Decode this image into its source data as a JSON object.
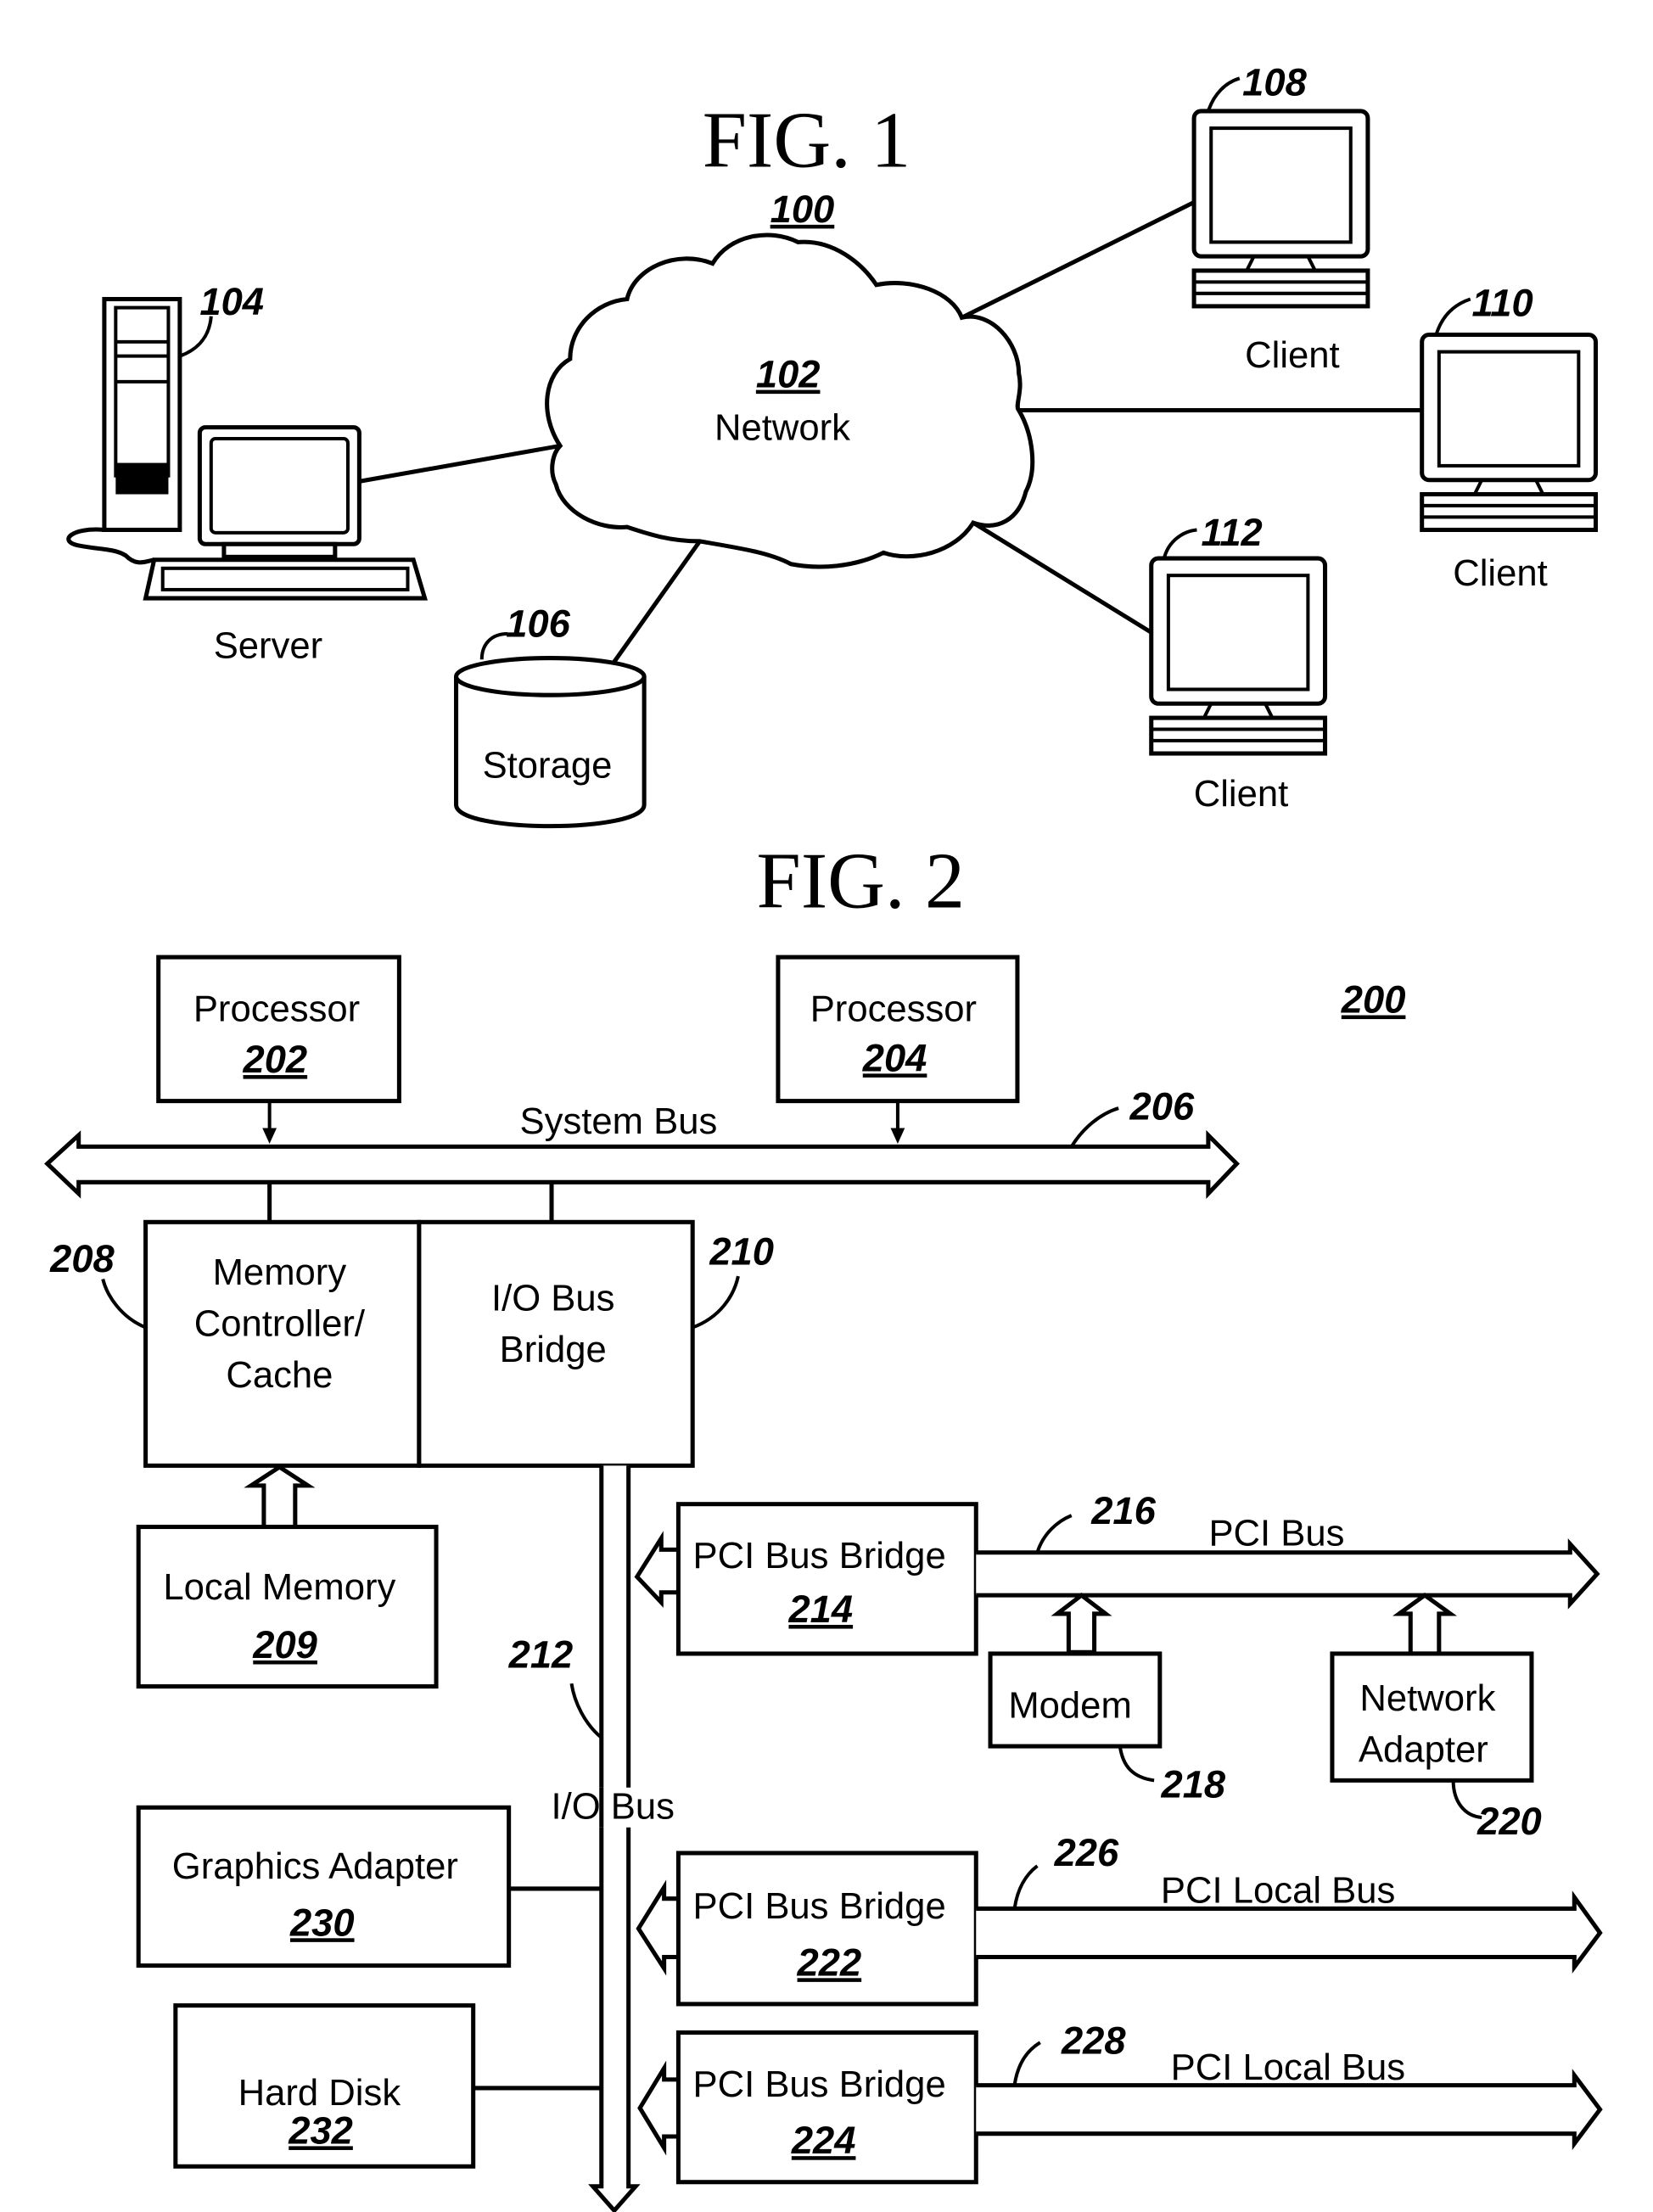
{
  "fig1": {
    "title": "FIG. 1",
    "ref": "100",
    "network": {
      "ref": "102",
      "label": "Network"
    },
    "server": {
      "ref": "104",
      "label": "Server"
    },
    "storage": {
      "ref": "106",
      "label": "Storage"
    },
    "clients": [
      {
        "ref": "108",
        "label": "Client"
      },
      {
        "ref": "110",
        "label": "Client"
      },
      {
        "ref": "112",
        "label": "Client"
      }
    ]
  },
  "fig2": {
    "title": "FIG. 2",
    "ref": "200",
    "processors": [
      {
        "label": "Processor",
        "ref": "202"
      },
      {
        "label": "Processor",
        "ref": "204"
      }
    ],
    "system_bus": {
      "label": "System Bus",
      "ref": "206"
    },
    "memory_controller": {
      "lines": [
        "Memory",
        "Controller/",
        "Cache"
      ],
      "ref": "208"
    },
    "io_bridge": {
      "lines": [
        "I/O Bus",
        "Bridge"
      ],
      "ref": "210"
    },
    "local_memory": {
      "label": "Local Memory",
      "ref": "209"
    },
    "io_bus": {
      "label": "I/O Bus",
      "ref": "212"
    },
    "pci_bridges": [
      {
        "label": "PCI Bus Bridge",
        "ref": "214",
        "bus_label": "PCI Bus",
        "bus_ref": "216"
      },
      {
        "label": "PCI Bus Bridge",
        "ref": "222",
        "bus_label": "PCI Local Bus",
        "bus_ref": "226"
      },
      {
        "label": "PCI Bus Bridge",
        "ref": "224",
        "bus_label": "PCI Local Bus",
        "bus_ref": "228"
      }
    ],
    "modem": {
      "label": "Modem",
      "ref": "218"
    },
    "network_adapter": {
      "lines": [
        "Network",
        "Adapter"
      ],
      "ref": "220"
    },
    "graphics_adapter": {
      "label": "Graphics Adapter",
      "ref": "230"
    },
    "hard_disk": {
      "label": "Hard Disk",
      "ref": "232"
    }
  }
}
